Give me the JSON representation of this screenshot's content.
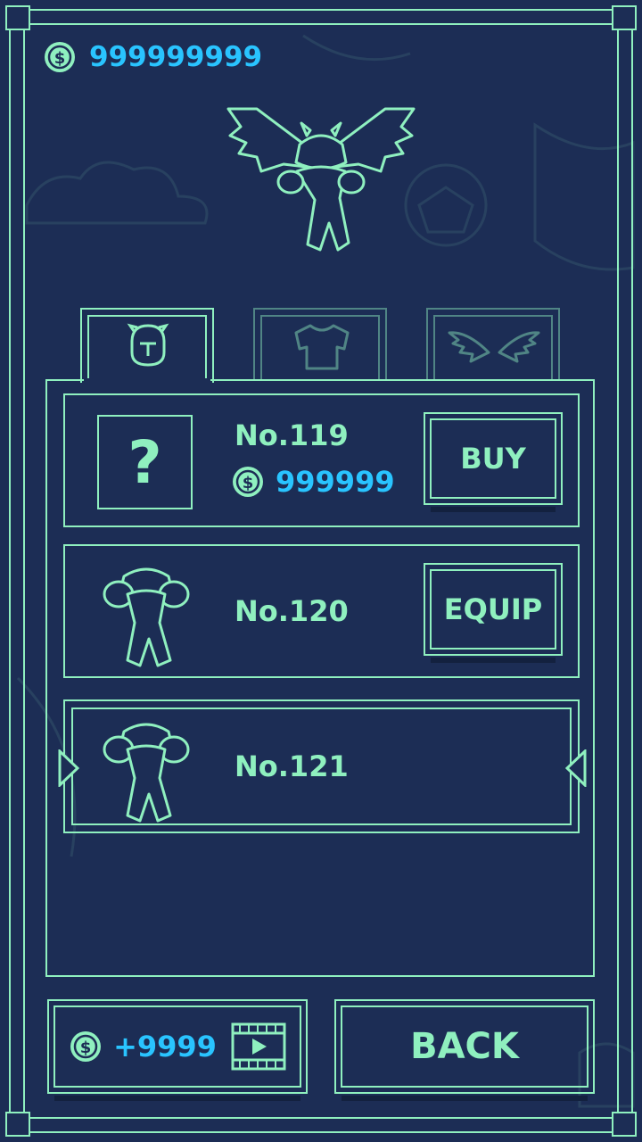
{
  "currency": {
    "balance": "999999999",
    "coin_icon": "coin-icon"
  },
  "preview": {
    "character_icon": "winged-monster-icon"
  },
  "tabs": [
    {
      "id": "head",
      "icon": "head-icon",
      "selected": true
    },
    {
      "id": "body",
      "icon": "shirt-icon",
      "selected": false
    },
    {
      "id": "wings",
      "icon": "wings-icon",
      "selected": false
    }
  ],
  "items": [
    {
      "number": "No.119",
      "price": "999999",
      "action": "BUY",
      "thumbnail": "question-mark-icon"
    },
    {
      "number": "No.120",
      "action": "EQUIP",
      "thumbnail": "monster-icon"
    },
    {
      "number": "No.121",
      "thumbnail": "monster-icon",
      "selected": true
    }
  ],
  "footer": {
    "reward_label": "+9999",
    "reward_icon": "video-ad-icon",
    "back_label": "BACK"
  },
  "colors": {
    "background": "#1c2d55",
    "line": "#8ff0bf",
    "coin_text": "#29c4ff"
  }
}
